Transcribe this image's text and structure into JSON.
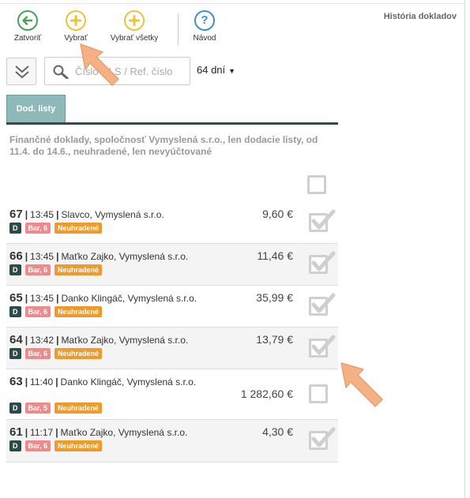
{
  "toolbar": {
    "close_label": "Zatvoriť",
    "select_label": "Vybrať",
    "select_all_label": "Vybrať všetky",
    "help_label": "Návod",
    "help_symbol": "?",
    "history_label": "História dokladov"
  },
  "search": {
    "placeholder": "Číslo DLS / Ref. číslo",
    "days_value": "64 dní",
    "days_caret": "▼"
  },
  "tabs": [
    {
      "label": "Dod. listy",
      "active": true
    }
  ],
  "filter_description": "Finančné doklady, spoločnosť Vymyslená s.r.o., len dodacie listy, od 11.4. do 14.6., neuhradené, len nevyúčtované",
  "documents": [
    {
      "number": "67",
      "time": "13:45",
      "customer": "Slavco, Vymyslená s.r.o.",
      "amount": "9,60 €",
      "type_badge": "D",
      "bar_badge": "Bar, 6",
      "status_badge": "Neuhradené",
      "checked": true
    },
    {
      "number": "66",
      "time": "13:45",
      "customer": "Maťko Zajko, Vymyslená s.r.o.",
      "amount": "11,46 €",
      "type_badge": "D",
      "bar_badge": "Bar, 6",
      "status_badge": "Neuhradené",
      "checked": true
    },
    {
      "number": "65",
      "time": "13:45",
      "customer": "Danko Klingáč, Vymyslená s.r.o.",
      "amount": "35,99 €",
      "type_badge": "D",
      "bar_badge": "Bar, 6",
      "status_badge": "Neuhradené",
      "checked": true
    },
    {
      "number": "64",
      "time": "13:42",
      "customer": "Maťko Zajko, Vymyslená s.r.o.",
      "amount": "13,79 €",
      "type_badge": "D",
      "bar_badge": "Bar, 6",
      "status_badge": "Neuhradené",
      "checked": true
    },
    {
      "number": "63",
      "time": "11:40",
      "customer": "Danko Klingáč, Vymyslená s.r.o.",
      "amount": "1 282,60 €",
      "type_badge": "D",
      "bar_badge": "Bar, 5",
      "status_badge": "Neuhradené",
      "checked": false
    },
    {
      "number": "61",
      "time": "11:17",
      "customer": "Maťko Zajko, Vymyslená s.r.o.",
      "amount": "4,30 €",
      "type_badge": "D",
      "bar_badge": "Bar, 6",
      "status_badge": "Neuhradené",
      "checked": true
    }
  ],
  "colors": {
    "close_icon": "#4aa05a",
    "select_icon": "#e8c53a",
    "help_icon": "#3f8fc8",
    "tab_active": "#8fb8b9",
    "tab_underline": "#2e4b4f",
    "badge_type": "#2b4a48",
    "badge_bar": "#f08a8a",
    "badge_status": "#f19a2c",
    "pointer_arrow": "#f4b183"
  },
  "icons": {
    "close": "arrow-left-circle-icon",
    "select": "plus-circle-icon",
    "select_all": "plus-circle-icon",
    "help": "question-circle-icon",
    "collapse": "double-chevron-down-icon",
    "search": "magnifier-icon",
    "checkbox_checked": "checkmark-icon"
  }
}
